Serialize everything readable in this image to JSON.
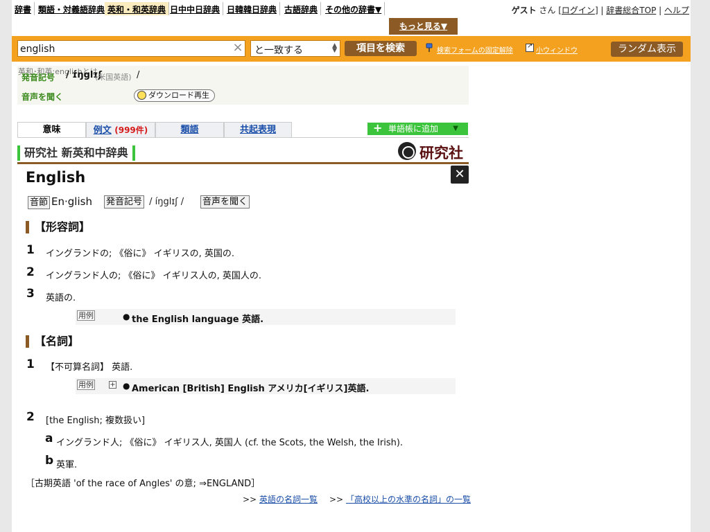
{
  "nav": {
    "items": [
      {
        "label": "辞書",
        "active": false
      },
      {
        "label": "類語・対義語辞典",
        "active": false
      },
      {
        "label": "英和・和英辞典",
        "active": true
      },
      {
        "label": "日中中日辞典",
        "active": false
      },
      {
        "label": "日韓韓日辞典",
        "active": false
      },
      {
        "label": "古語辞典",
        "active": false
      },
      {
        "label": "その他の辞書▼",
        "active": false
      }
    ],
    "user_guest": "ゲスト",
    "user_san": " さん [",
    "login": "ログイン",
    "login_close": "] | ",
    "top_link": "辞書総合TOP",
    "sep": " | ",
    "help_link": "ヘルプ",
    "more_button": "もっと見る▼"
  },
  "search": {
    "query": "english",
    "clear_glyph": "×",
    "match_mode": "と一致する",
    "search_button": "項目を検索",
    "unpin_link": "検索フォームの固定解除",
    "small_window_link": "小ウィンドウ",
    "random_button": "ランダム表示"
  },
  "pron": {
    "breadcrumb": "英和･和英:englishとは",
    "label_phonetic": "発音記号",
    "phonetic": "/ ɪ́ŋglɪʃ",
    "region": "(米国英語)",
    "phonetic_end": "/",
    "label_listen": "音声を聞く",
    "download_button": "ダウンロード再生"
  },
  "tabs": [
    {
      "label": "意味",
      "count": "",
      "active": true
    },
    {
      "label": "例文",
      "count": "(999件)",
      "active": false
    },
    {
      "label": "類語",
      "count": "",
      "active": false
    },
    {
      "label": "共起表現",
      "count": "",
      "active": false
    }
  ],
  "add_wordbook": "単語帳に追加",
  "dictionary": {
    "title": "研究社 新英和中辞典",
    "publisher_logo": "研究社",
    "close_glyph": "✕"
  },
  "entry": {
    "headword": "English",
    "syllable_label": "音節",
    "syllable_value": "En·glish",
    "phonetic_label": "発音記号",
    "phonetic_value": "/ íŋglɪʃ /",
    "listen_label": "音声を聞く",
    "adj_section": "【形容詞】",
    "adj_defs": [
      {
        "num": "1",
        "text": "イングランドの; 《俗に》 イギリスの, 英国の."
      },
      {
        "num": "2",
        "text": "イングランド人の; 《俗に》 イギリス人の, 英国人の."
      },
      {
        "num": "3",
        "text": "英語の."
      }
    ],
    "example_label": "用例",
    "adj_example": "the English language 英語.",
    "noun_section": "【名詞】",
    "noun_def1_num": "1",
    "noun_def1": "【不可算名詞】 英語.",
    "noun_example": "American [British] English アメリカ[イギリス]英語.",
    "noun_def2_num": "2",
    "noun_def2": "[the English; 複数扱い]",
    "sub_a_letter": "a",
    "sub_a": "イングランド人; 《俗に》 イギリス人, 英国人 (cf. the Scots, the Welsh, the Irish).",
    "sub_b_letter": "b",
    "sub_b": "英軍.",
    "etymology": "［古期英語 'of the race of Angles' の意; ⇒ENGLAND］",
    "link_prefix1": ">> ",
    "link1": "英語の名詞一覧",
    "link_prefix2": ">> ",
    "link2": "「高校以上の水準の名詞」の一覧"
  }
}
